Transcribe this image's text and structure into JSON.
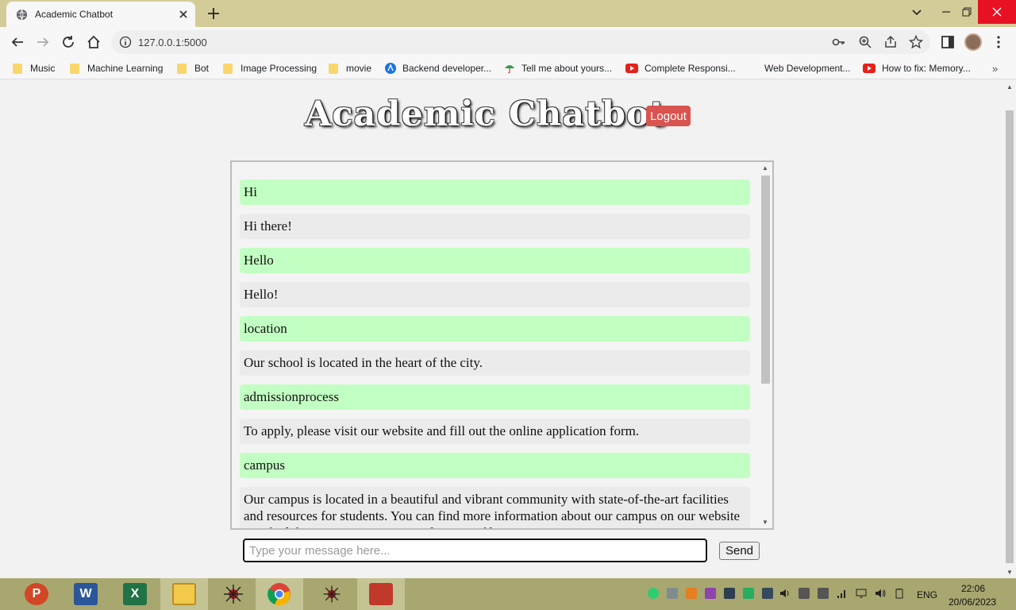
{
  "browser": {
    "tab_title": "Academic Chatbot",
    "url": "127.0.0.1:5000",
    "bookmarks": [
      {
        "label": "Music",
        "icon": "folder-icon"
      },
      {
        "label": "Machine Learning",
        "icon": "folder-icon"
      },
      {
        "label": "Bot",
        "icon": "folder-icon"
      },
      {
        "label": "Image Processing",
        "icon": "folder-icon"
      },
      {
        "label": "movie",
        "icon": "folder-icon"
      },
      {
        "label": "Backend developer...",
        "icon": "site-icon"
      },
      {
        "label": "Tell me about yours...",
        "icon": "umbrella-icon"
      },
      {
        "label": "Complete Responsi...",
        "icon": "youtube-icon"
      },
      {
        "label": "Web Development...",
        "icon": "none"
      },
      {
        "label": "How to fix: Memory...",
        "icon": "youtube-icon"
      }
    ]
  },
  "page": {
    "title": "Academic Chatbot",
    "logout_label": "Logout",
    "messages": [
      {
        "role": "user",
        "text": "Hi"
      },
      {
        "role": "bot",
        "text": "Hi there!"
      },
      {
        "role": "user",
        "text": "Hello"
      },
      {
        "role": "bot",
        "text": "Hello!"
      },
      {
        "role": "user",
        "text": "location"
      },
      {
        "role": "bot",
        "text": "Our school is located in the heart of the city."
      },
      {
        "role": "user",
        "text": "admissionprocess"
      },
      {
        "role": "bot",
        "text": "To apply, please visit our website and fill out the online application form."
      },
      {
        "role": "user",
        "text": "campus"
      },
      {
        "role": "bot",
        "text": "Our campus is located in a beautiful and vibrant community with state-of-the-art facilities and resources for students. You can find more information about our campus on our website or schedule a campus tour to visit for yourself."
      }
    ],
    "input_placeholder": "Type your message here...",
    "input_value": "",
    "send_label": "Send"
  },
  "taskbar": {
    "apps": [
      "PowerPoint",
      "Word",
      "Excel",
      "File Explorer",
      "App",
      "Chrome",
      "App",
      "App"
    ],
    "language": "ENG",
    "time": "22:06",
    "date": "20/06/2023"
  },
  "colors": {
    "user_bubble": "#c2ffc2",
    "bot_bubble": "#ebebeb",
    "logout": "#d9534f",
    "tabbar": "#d4cc98",
    "taskbar": "#a8a76f"
  }
}
